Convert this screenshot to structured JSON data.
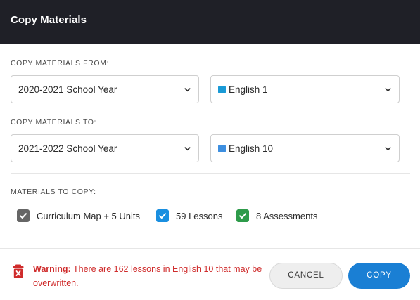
{
  "dialog": {
    "title": "Copy Materials"
  },
  "from": {
    "label": "COPY MATERIALS FROM:",
    "year": "2020-2021 School Year",
    "course": "English 1",
    "course_color": "#1a9ad6"
  },
  "to": {
    "label": "COPY MATERIALS TO:",
    "year": "2021-2022 School Year",
    "course": "English 10",
    "course_color": "#3d8fe0"
  },
  "materials": {
    "label": "MATERIALS TO COPY:",
    "items": [
      {
        "label": "Curriculum Map + 5 Units",
        "checked": true,
        "color": "#666666"
      },
      {
        "label": "59 Lessons",
        "checked": true,
        "color": "#1a8fe0"
      },
      {
        "label": "8 Assessments",
        "checked": true,
        "color": "#2e9b4a"
      }
    ]
  },
  "footer": {
    "warning_prefix": "Warning:",
    "warning_text": " There are 162 lessons in English 10 that may be overwritten.",
    "cancel_label": "CANCEL",
    "copy_label": "COPY",
    "warning_color": "#cf2b2b",
    "copy_color": "#1a7fd4"
  }
}
